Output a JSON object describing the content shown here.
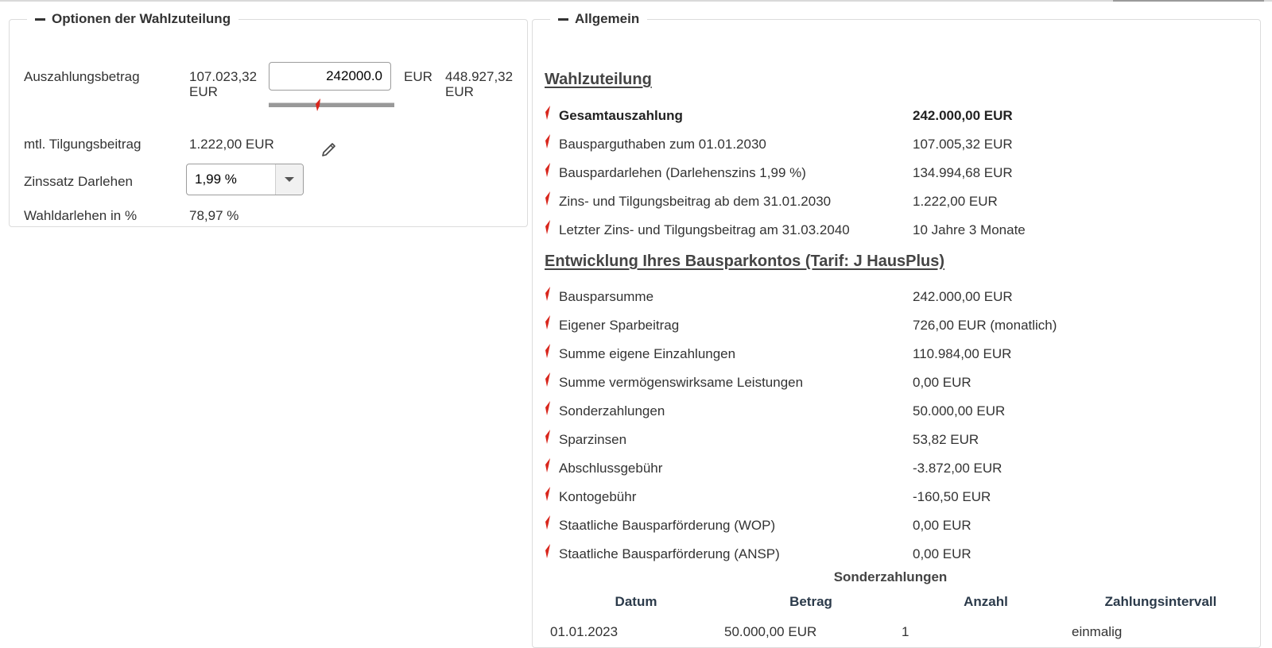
{
  "left_panel": {
    "title": "Optionen der Wahlzuteilung",
    "auszahlung": {
      "label": "Auszahlungsbetrag",
      "min_line1": "107.023,32",
      "min_line2": "EUR",
      "input_value": "242000.0",
      "unit": "EUR",
      "max_line1": "448.927,32",
      "max_line2": "EUR",
      "slider_position_fraction": 0.39
    },
    "tilgung": {
      "label": "mtl. Tilgungsbeitrag",
      "value": "1.222,00 EUR"
    },
    "zinssatz": {
      "label": "Zinssatz Darlehen",
      "selected": "1,99 %"
    },
    "wahldarlehen": {
      "label": "Wahldarlehen in %",
      "value": "78,97 %"
    }
  },
  "right_panel": {
    "title": "Allgemein",
    "wahlzuteilung": {
      "heading": "Wahlzuteilung",
      "rows": [
        {
          "label": "Gesamtauszahlung",
          "value": "242.000,00 EUR"
        },
        {
          "label": "Bausparguthaben zum 01.01.2030",
          "value": "107.005,32 EUR"
        },
        {
          "label": "Bauspardarlehen (Darlehenszins 1,99 %)",
          "value": "134.994,68 EUR"
        },
        {
          "label": "Zins- und Tilgungsbeitrag ab dem 31.01.2030",
          "value": "1.222,00 EUR"
        },
        {
          "label": "Letzter Zins- und Tilgungsbeitrag am 31.03.2040",
          "value": "10 Jahre 3 Monate"
        }
      ]
    },
    "entwicklung": {
      "heading": "Entwicklung Ihres Bausparkontos (Tarif: J HausPlus)",
      "rows": [
        {
          "label": "Bausparsumme",
          "value": "242.000,00 EUR"
        },
        {
          "label": "Eigener Sparbeitrag",
          "value": "726,00 EUR (monatlich)"
        },
        {
          "label": "Summe eigene Einzahlungen",
          "value": "110.984,00 EUR"
        },
        {
          "label": "Summe vermögenswirksame Leistungen",
          "value": "0,00 EUR"
        },
        {
          "label": "Sonderzahlungen",
          "value": "50.000,00 EUR"
        },
        {
          "label": "Sparzinsen",
          "value": "53,82 EUR"
        },
        {
          "label": "Abschlussgebühr",
          "value": "-3.872,00 EUR"
        },
        {
          "label": "Kontogebühr",
          "value": "-160,50 EUR"
        },
        {
          "label": "Staatliche Bausparförderung (WOP)",
          "value": "0,00 EUR"
        },
        {
          "label": "Staatliche Bausparförderung (ANSP)",
          "value": "0,00 EUR"
        }
      ]
    },
    "sonderzahlungen_table": {
      "caption": "Sonderzahlungen",
      "headers": [
        "Datum",
        "Betrag",
        "Anzahl",
        "Zahlungsintervall"
      ],
      "rows": [
        [
          "01.01.2023",
          "50.000,00 EUR",
          "1",
          "einmalig"
        ]
      ]
    }
  },
  "colors": {
    "accent_red": "#d9261c",
    "text": "#333333",
    "border": "#dcdcdc"
  }
}
